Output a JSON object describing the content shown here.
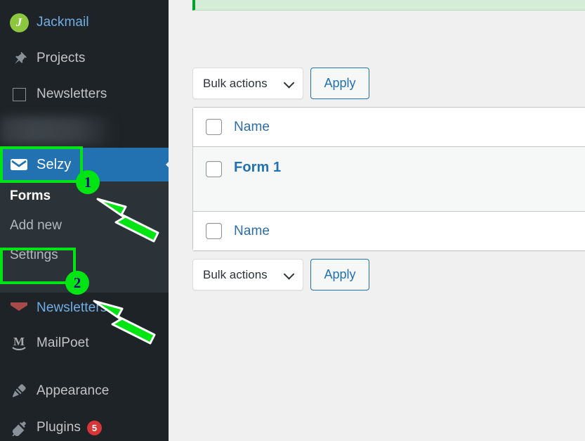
{
  "sidebar": {
    "items": [
      {
        "label": "Jackmail",
        "icon": "jackmail-logo-icon",
        "style": "blue"
      },
      {
        "label": "Projects",
        "icon": "pushpin-icon",
        "style": "plain"
      },
      {
        "label": "Newsletters",
        "icon": "square-outline-icon",
        "style": "plain"
      },
      {
        "label": "",
        "icon": "redacted-icon",
        "style": "redacted"
      }
    ],
    "active_item": {
      "label": "Selzy",
      "icon": "envelope-icon"
    },
    "submenu": [
      {
        "label": "Forms",
        "current": true
      },
      {
        "label": "Add new",
        "current": false
      },
      {
        "label": "Settings",
        "current": false
      }
    ],
    "lower_items": [
      {
        "label": "Newsletters",
        "icon": "red-envelope-icon",
        "badge": ""
      },
      {
        "label": "MailPoet",
        "icon": "mailpoet-m-icon",
        "badge": ""
      },
      {
        "label": "Appearance",
        "icon": "paintbrush-icon",
        "badge": ""
      },
      {
        "label": "Plugins",
        "icon": "plug-icon",
        "badge": "5"
      }
    ]
  },
  "annotations": {
    "marker_1": "1",
    "marker_2": "2",
    "highlight_color": "#00e413",
    "marker_text_color": "#0b0b7a"
  },
  "main": {
    "notice": {
      "text": "",
      "accent_color": "#00a32a",
      "background": "#d5ecd8"
    },
    "tablenav_top": {
      "bulk_label": "Bulk actions",
      "apply_label": "Apply"
    },
    "tablenav_bottom": {
      "bulk_label": "Bulk actions",
      "apply_label": "Apply"
    },
    "table": {
      "header": {
        "name": "Name"
      },
      "rows": [
        {
          "title": "Form 1"
        }
      ],
      "footer": {
        "name": "Name"
      }
    }
  },
  "colors": {
    "sidebar_bg": "#1d2327",
    "submenu_bg": "#2c3338",
    "active_blue": "#2271b1",
    "link_blue": "#2271b1",
    "badge_red": "#d63638",
    "content_bg": "#f0f0f1"
  }
}
